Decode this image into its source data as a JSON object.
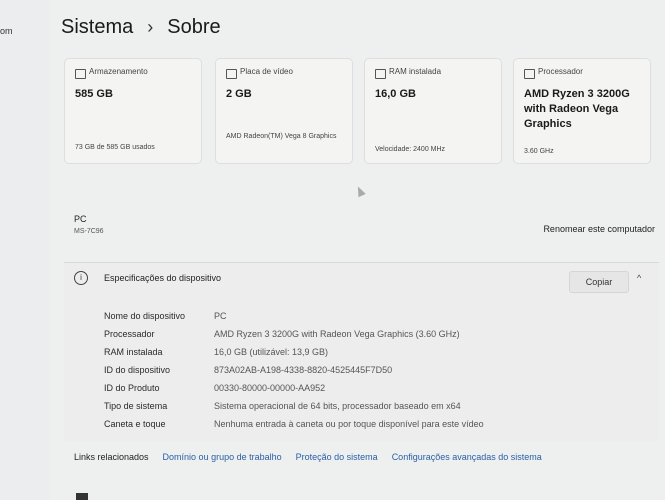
{
  "left": {
    "text": "om"
  },
  "breadcrumb": {
    "parent": "Sistema",
    "separator": "›",
    "current": "Sobre"
  },
  "cards": [
    {
      "label": "Armazenamento",
      "value": "585 GB",
      "sub": "73 GB de 585 GB usados"
    },
    {
      "label": "Placa de vídeo",
      "value": "2 GB",
      "sub": "AMD Radeon(TM) Vega 8 Graphics"
    },
    {
      "label": "RAM instalada",
      "value": "16,0 GB",
      "sub": "Velocidade: 2400 MHz"
    },
    {
      "label": "Processador",
      "value": "AMD Ryzen 3 3200G with Radeon Vega Graphics",
      "sub": "3.60 GHz"
    }
  ],
  "device": {
    "name": "PC",
    "model": "MS-7C96",
    "rename_label": "Renomear este computador"
  },
  "specs": {
    "title": "Especificações do dispositivo",
    "copy_label": "Copiar",
    "rows": [
      {
        "key": "Nome do dispositivo",
        "value": "PC"
      },
      {
        "key": "Processador",
        "value": "AMD Ryzen 3 3200G with Radeon Vega Graphics    (3.60 GHz)"
      },
      {
        "key": "RAM instalada",
        "value": "16,0 GB (utilizável: 13,9 GB)"
      },
      {
        "key": "ID do dispositivo",
        "value": "873A02AB-A198-4338-8820-4525445F7D50"
      },
      {
        "key": "ID do Produto",
        "value": "00330-80000-00000-AA952"
      },
      {
        "key": "Tipo de sistema",
        "value": "Sistema operacional de 64 bits, processador baseado em x64"
      },
      {
        "key": "Caneta e toque",
        "value": "Nenhuma entrada à caneta ou por toque disponível para este vídeo"
      }
    ]
  },
  "related": {
    "label": "Links relacionados",
    "links": [
      "Domínio ou grupo de trabalho",
      "Proteção do sistema",
      "Configurações avançadas do sistema"
    ]
  }
}
